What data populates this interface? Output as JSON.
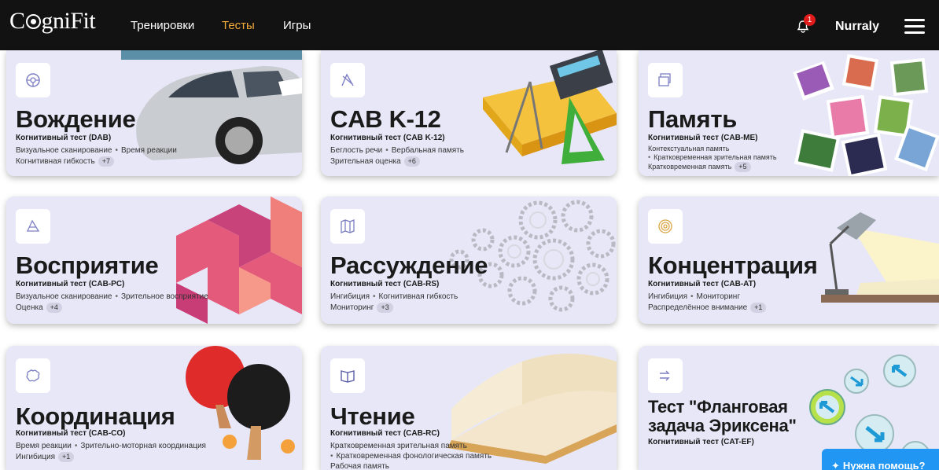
{
  "nav": {
    "logo": "CognIFit",
    "logo_pre": "C",
    "logo_post": "gniFit",
    "links": [
      "Тренировки",
      "Тесты",
      "Игры"
    ],
    "notification_count": "1",
    "user": "Nurraly",
    "active_color": "#f2a93b",
    "bg_color": "#121212"
  },
  "cards": [
    {
      "title": "Вождение",
      "subtitle": "Когнитивный тест (DAB)",
      "line1": [
        "Визуальное сканирование",
        "Время реакции"
      ],
      "line2": "Когнитивная гибкость",
      "more": "+7",
      "icon": "steering-wheel-icon"
    },
    {
      "title": "CAB K-12",
      "subtitle": "Когнитивный тест (CAB K-12)",
      "line1": [
        "Беглость речи",
        "Вербальная память"
      ],
      "line2": "Зрительная оценка",
      "more": "+6",
      "icon": "school-supplies-icon"
    },
    {
      "title": "Память",
      "subtitle": "Когнитивный тест (CAB-ME)",
      "line1": [
        "Контекстуальная память"
      ],
      "line1b": "Кратковременная зрительная память",
      "line2": "Кратковременная память",
      "more": "+5",
      "icon": "photos-icon"
    },
    {
      "title": "Восприятие",
      "subtitle": "Когнитивный тест (CAB-PC)",
      "line1": [
        "Визуальное сканирование",
        "Зрительное восприятие"
      ],
      "line2": "Оценка",
      "more": "+4",
      "icon": "triangle-shape-icon"
    },
    {
      "title": "Рассуждение",
      "subtitle": "Когнитивный тест (CAB-RS)",
      "line1": [
        "Ингибиция",
        "Когнитивная гибкость"
      ],
      "line2": "Мониторинг",
      "more": "+3",
      "icon": "map-icon"
    },
    {
      "title": "Концентрация",
      "subtitle": "Когнитивный тест (CAB-AT)",
      "line1": [
        "Ингибиция",
        "Мониторинг"
      ],
      "line2": "Распределённое внимание",
      "more": "+1",
      "icon": "target-icon"
    },
    {
      "title": "Координация",
      "subtitle": "Когнитивный тест (CAB-CO)",
      "line1": [
        "Время реакции",
        "Зрительно-моторная координация"
      ],
      "line2": "Ингибиция",
      "more": "+1",
      "icon": "brain-icon"
    },
    {
      "title": "Чтение",
      "subtitle": "Когнитивный тест (CAB-RC)",
      "line1": [
        "Кратковременная зрительная память"
      ],
      "line1b": "Кратковременная фонологическая память",
      "line2": "Рабочая память",
      "more": "",
      "icon": "book-icon"
    },
    {
      "title": "Тест \"Фланговая задача Эриксена\"",
      "title_line1": "Тест \"Фланговая",
      "title_line2": "задача Эриксена\"",
      "subtitle": "Когнитивный тест (CAT-EF)",
      "icon": "arrows-icon"
    }
  ],
  "help_button": "Нужна помощь?"
}
